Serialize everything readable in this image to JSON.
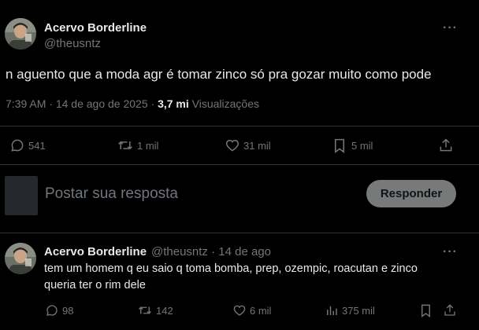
{
  "main_tweet": {
    "display_name": "Acervo Borderline",
    "handle": "@theusntz",
    "more_label": "···",
    "text": "n aguento que a moda agr é tomar zinco só pra gozar muito como pode",
    "time": "7:39 AM",
    "date": "14 de ago de 2025",
    "separator": "·",
    "views_count": "3,7 mi",
    "views_label": "Visualizações",
    "actions": {
      "replies": "541",
      "reposts": "1 mil",
      "likes": "31 mil",
      "bookmarks": "5 mil"
    }
  },
  "reply_composer": {
    "placeholder": "Postar sua resposta",
    "button_label": "Responder"
  },
  "reply_tweet": {
    "display_name": "Acervo Borderline",
    "handle": "@theusntz",
    "separator": "·",
    "date": "14 de ago",
    "more_label": "···",
    "line1": "tem um homem q eu saio q toma bomba, prep, ozempic, roacutan e zinco",
    "line2": "queria ter o rim dele",
    "actions": {
      "replies": "98",
      "reposts": "142",
      "likes": "6 mil",
      "views": "375 mil"
    }
  },
  "icons": [
    "avatar",
    "more-icon",
    "reply-icon",
    "repost-icon",
    "like-icon",
    "bookmark-icon",
    "share-icon",
    "views-icon"
  ],
  "colors": {
    "background": "#000000",
    "text": "#e7e9ea",
    "muted": "#71767b",
    "divider": "#2f3336",
    "button": "#787a7a"
  }
}
